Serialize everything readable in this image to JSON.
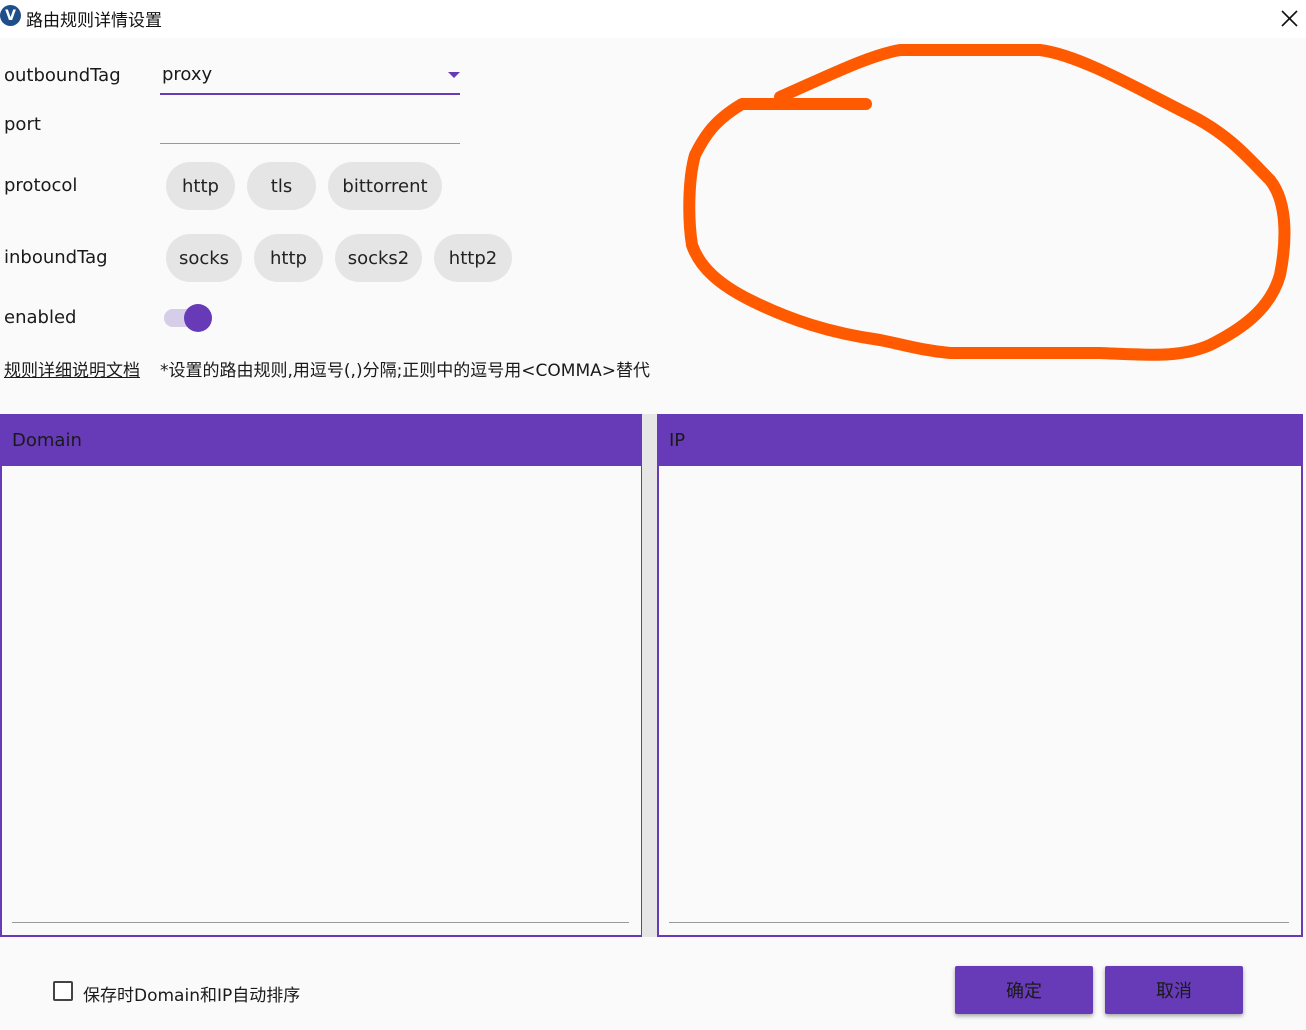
{
  "window": {
    "title": "路由规则详情设置",
    "app_icon_letter": "V",
    "close_glyph": "×"
  },
  "form": {
    "outbound_tag": {
      "label": "outboundTag",
      "value": "proxy"
    },
    "port": {
      "label": "port",
      "value": ""
    },
    "protocol": {
      "label": "protocol",
      "chips": [
        "http",
        "tls",
        "bittorrent"
      ]
    },
    "inbound_tag": {
      "label": "inboundTag",
      "chips": [
        "socks",
        "http",
        "socks2",
        "http2"
      ]
    },
    "enabled": {
      "label": "enabled",
      "on": true
    }
  },
  "help": {
    "doc_link": "规则详细说明文档",
    "hint": "*设置的路由规则,用逗号(,)分隔;正则中的逗号用<COMMA>替代"
  },
  "panels": {
    "domain": {
      "header": "Domain",
      "content": ""
    },
    "ip": {
      "header": "IP",
      "content": ""
    }
  },
  "footer": {
    "sort_checkbox_label": "保存时Domain和IP自动排序",
    "sort_checked": false,
    "ok_label": "确定",
    "cancel_label": "取消"
  },
  "colors": {
    "accent": "#673ab7",
    "chip_bg": "#e5e5e5",
    "annotation": "#ff5a00"
  },
  "icons": {
    "app": "v2ray-logo-icon",
    "close": "close-icon",
    "dropdown": "chevron-down-icon"
  }
}
